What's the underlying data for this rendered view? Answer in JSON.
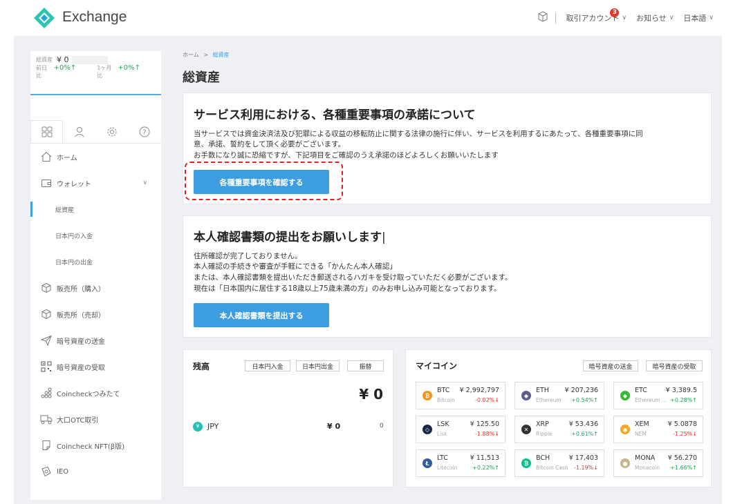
{
  "header": {
    "brand": "Exchange",
    "account_label": "取引アカウント",
    "notification_count": "3",
    "news_label": "お知らせ",
    "lang_label": "日本語",
    "accent": "#3c9ee0"
  },
  "sidebar": {
    "summary": {
      "total_label": "総資産",
      "total_value": "¥ 0",
      "day_label": "前日比",
      "day_value": "+0%↑",
      "month_label": "1ヶ月比",
      "month_value": "+0%↑"
    },
    "items": [
      {
        "label": "ホーム",
        "icon": "home-icon"
      },
      {
        "label": "ウォレット",
        "icon": "wallet-icon"
      },
      {
        "label": "総資産"
      },
      {
        "label": "日本円の入金"
      },
      {
        "label": "日本円の出金"
      },
      {
        "label": "販売所（購入）",
        "icon": "cube-icon"
      },
      {
        "label": "販売所（売却）",
        "icon": "cube-icon"
      },
      {
        "label": "暗号資産の送金",
        "icon": "send-icon"
      },
      {
        "label": "暗号資産の受取",
        "icon": "qr-icon"
      },
      {
        "label": "Coincheckつみたて",
        "icon": "coins-icon"
      },
      {
        "label": "大口OTC取引",
        "icon": "truck-icon"
      },
      {
        "label": "Coincheck NFT(β版)",
        "icon": "nft-icon"
      },
      {
        "label": "IEO",
        "icon": "ieo-icon"
      }
    ]
  },
  "main": {
    "breadcrumb_home": "ホーム",
    "breadcrumb_sep": ">",
    "breadcrumb_current": "総資産",
    "title": "総資産",
    "consent": {
      "title": "サービス利用における、各種重要事項の承諾について",
      "line1": "当サービスでは資金決済法及び犯罪による収益の移転防止に関する法律の施行に伴い、サービスを利用するにあたって、各種重要事項に同",
      "line2": "意、承諾、誓約をして頂く必要がございます。",
      "line3": "お手数になり誠に恐縮ですが、下記項目をご確認のうえ承諾のほどよろしくお願いいたします",
      "button": "各種重要事項を確認する"
    },
    "identity": {
      "title": "本人確認書類の提出をお願いします",
      "line1": "住所確認が完了しておりません。",
      "line2": "本人確認の手続きや審査が手軽にできる「かんたん本人確認」",
      "line3": "または、本人確認書類を提出いただき郵送されるハガキを受け取っていただく必要がございます。",
      "line4": "現在は「日本国内に居住する18歳以上75歳未満の方」のみお申し込み可能となっております。",
      "button": "本人確認書類を提出する"
    },
    "balance": {
      "title": "残高",
      "deposit": "日本円入金",
      "withdraw": "日本円出金",
      "transfer": "振替",
      "total": "¥ 0",
      "currency": "JPY",
      "amount": "¥ 0",
      "qty": "0"
    },
    "mycoin": {
      "title": "マイコイン",
      "send": "暗号資産の送金",
      "receive": "暗号資産の受取",
      "coins": [
        {
          "sym": "BTC",
          "name": "Bitcoin",
          "price": "¥ 2,992,797",
          "change": "-0.02%↓",
          "dir": "down",
          "color": "#f7931a",
          "glyph": "₿"
        },
        {
          "sym": "ETH",
          "name": "Ethereum",
          "price": "¥ 207,236",
          "change": "+0.54%↑",
          "dir": "up",
          "color": "#5b5f8a",
          "glyph": "◆"
        },
        {
          "sym": "ETC",
          "name": "Ethereum ...",
          "price": "¥ 3,389.5",
          "change": "+0.28%↑",
          "dir": "up",
          "color": "#3ab83a",
          "glyph": "◆"
        },
        {
          "sym": "LSK",
          "name": "Lisk",
          "price": "¥ 125.50",
          "change": "-1.88%↓",
          "dir": "down",
          "color": "#1a2a44",
          "glyph": "◇"
        },
        {
          "sym": "XRP",
          "name": "Ripple",
          "price": "¥ 53.436",
          "change": "+0.61%↑",
          "dir": "up",
          "color": "#333333",
          "glyph": "✕"
        },
        {
          "sym": "XEM",
          "name": "NEM",
          "price": "¥ 5.0878",
          "change": "-1.25%↓",
          "dir": "down",
          "color": "#f5a623",
          "glyph": "◉"
        },
        {
          "sym": "LTC",
          "name": "Litecoin",
          "price": "¥ 11,513",
          "change": "+0.22%↑",
          "dir": "up",
          "color": "#345d9d",
          "glyph": "Ł"
        },
        {
          "sym": "BCH",
          "name": "Bitcoin Cash",
          "price": "¥ 17,403",
          "change": "-1.19%↓",
          "dir": "down",
          "color": "#0ac18e",
          "glyph": "₿"
        },
        {
          "sym": "MONA",
          "name": "Monacoin",
          "price": "¥ 56.270",
          "change": "+1.66%↑",
          "dir": "up",
          "color": "#c9b48f",
          "glyph": "●"
        }
      ]
    }
  }
}
